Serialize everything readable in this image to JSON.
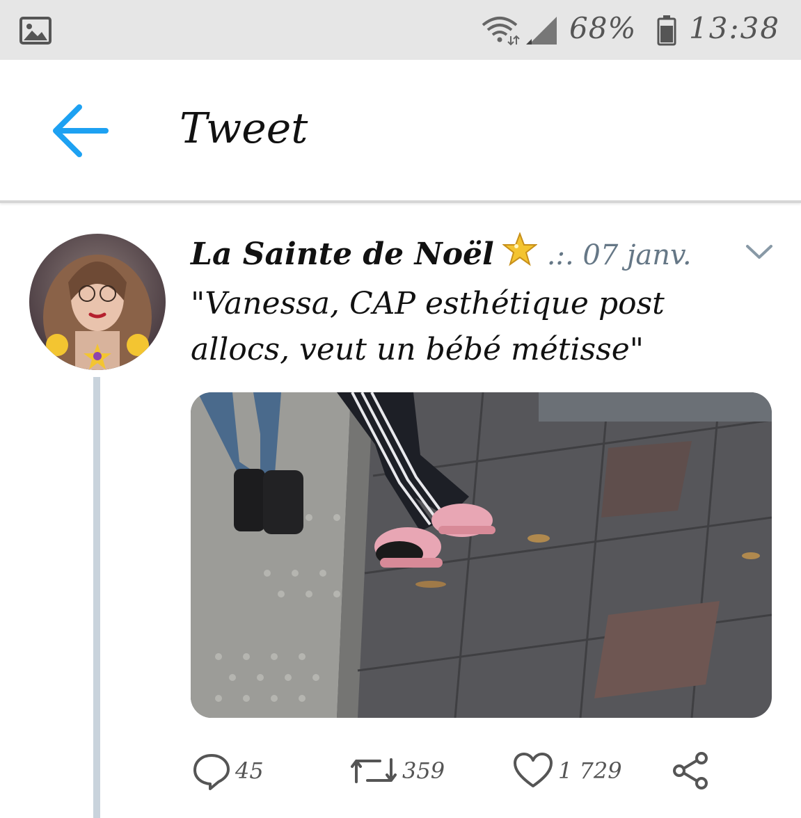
{
  "status_bar": {
    "battery": "68%",
    "time": "13:38",
    "icons": [
      "gallery-icon",
      "wifi-icon",
      "signal-icon",
      "battery-icon"
    ]
  },
  "header": {
    "title": "Tweet",
    "back_icon": "back-arrow-icon",
    "accent_color": "#1da1f2"
  },
  "tweet": {
    "display_name": "La Sainte de Noël",
    "badge_icon": "star-icon",
    "date": ".:. 07 janv.",
    "text": "\"Vanessa, CAP esthétique post allocs, veut un bébé métisse\"",
    "menu_icon": "chevron-down-icon",
    "actions": {
      "replies": "45",
      "retweets": "359",
      "likes": "1 729"
    }
  }
}
